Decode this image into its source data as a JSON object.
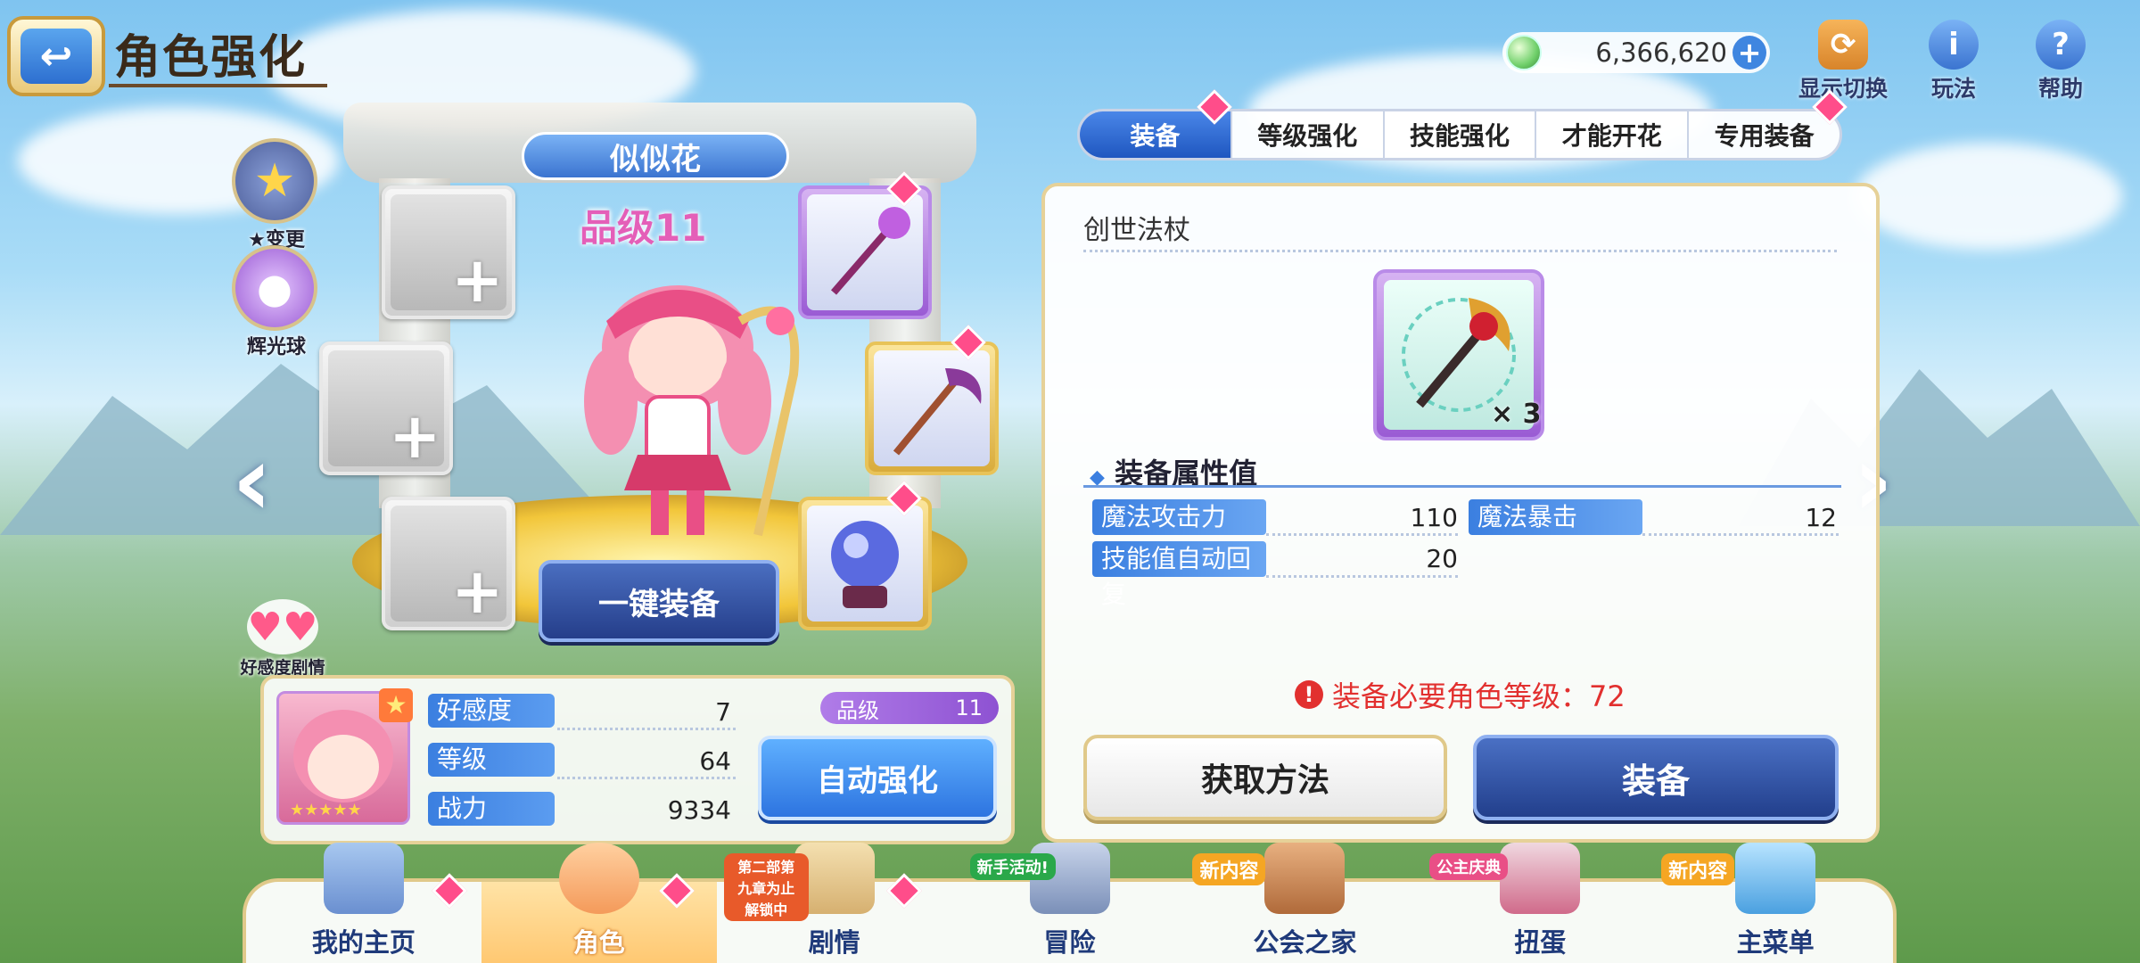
{
  "header": {
    "back_icon": "back-arrow-icon",
    "title": "角色强化"
  },
  "currency": {
    "icon": "jewel-icon",
    "value": "6,366,620",
    "plus": "+"
  },
  "top_actions": [
    {
      "icon": "display-switch-icon",
      "label": "显示切换"
    },
    {
      "icon": "info-icon",
      "label": "玩法"
    },
    {
      "icon": "help-icon",
      "label": "帮助"
    }
  ],
  "side_buttons": [
    {
      "icon": "star-change-icon",
      "label": "★变更"
    },
    {
      "icon": "glow-orb-icon",
      "label": "辉光球"
    }
  ],
  "character": {
    "name": "似似花",
    "rank_text": "品级11",
    "one_key_equip": "一键装备",
    "affection_story_label": "好感度剧情"
  },
  "stats": {
    "rows": [
      {
        "label": "好感度",
        "value": "7"
      },
      {
        "label": "等级",
        "value": "64"
      },
      {
        "label": "战力",
        "value": "9334"
      }
    ],
    "rank_label": "品级",
    "rank_value": "11",
    "auto_enhance": "自动强化"
  },
  "tabs": [
    "装备",
    "等级强化",
    "技能强化",
    "才能开花",
    "专用装备"
  ],
  "equipment": {
    "name": "创世法杖",
    "quantity": "× 3",
    "section_title": "装备属性值",
    "attributes": [
      {
        "label": "魔法攻击力",
        "value": "110"
      },
      {
        "label": "魔法暴击",
        "value": "12"
      },
      {
        "label": "技能值自动回复",
        "value": "20"
      }
    ],
    "requirement": "装备必要角色等级：72",
    "get_method": "获取方法",
    "equip": "装备"
  },
  "nav": [
    {
      "label": "我的主页",
      "badge": ""
    },
    {
      "label": "角色",
      "badge": ""
    },
    {
      "label": "剧情",
      "badge": "第二部第九章为止解锁中"
    },
    {
      "label": "冒险",
      "badge": "新手活动!"
    },
    {
      "label": "公会之家",
      "badge": "新内容"
    },
    {
      "label": "扭蛋",
      "badge": "公主庆典"
    },
    {
      "label": "主菜单",
      "badge": "新内容"
    }
  ],
  "colors": {
    "accent_blue": "#2d6fd0",
    "badge_pink": "#ff4d8a",
    "warning_red": "#e2302f",
    "rank_purple": "#9a5bd4"
  }
}
